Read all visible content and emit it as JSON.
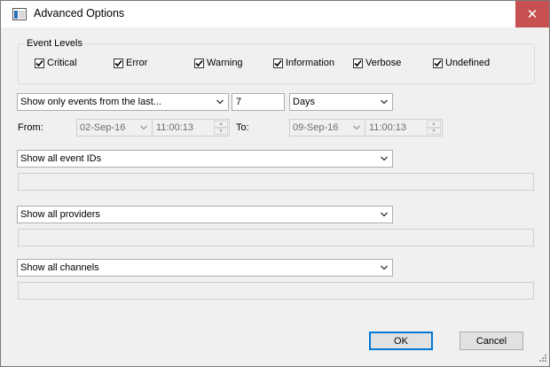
{
  "window": {
    "title": "Advanced Options",
    "close_symbol": "✕"
  },
  "event_levels": {
    "label": "Event Levels",
    "items": [
      {
        "label": "Critical",
        "checked": true
      },
      {
        "label": "Error",
        "checked": true
      },
      {
        "label": "Warning",
        "checked": true
      },
      {
        "label": "Information",
        "checked": true
      },
      {
        "label": "Verbose",
        "checked": true
      },
      {
        "label": "Undefined",
        "checked": true
      }
    ]
  },
  "time_filter": {
    "range_select": "Show only events from the last...",
    "amount": "7",
    "unit_select": "Days",
    "from_label": "From:",
    "from_date": "02-Sep-16",
    "from_time": "11:00:13",
    "to_label": "To:",
    "to_date": "09-Sep-16",
    "to_time": "11:00:13"
  },
  "event_ids": {
    "select": "Show all event IDs",
    "text": ""
  },
  "providers": {
    "select": "Show all providers",
    "text": ""
  },
  "channels": {
    "select": "Show all channels",
    "text": ""
  },
  "buttons": {
    "ok": "OK",
    "cancel": "Cancel"
  }
}
